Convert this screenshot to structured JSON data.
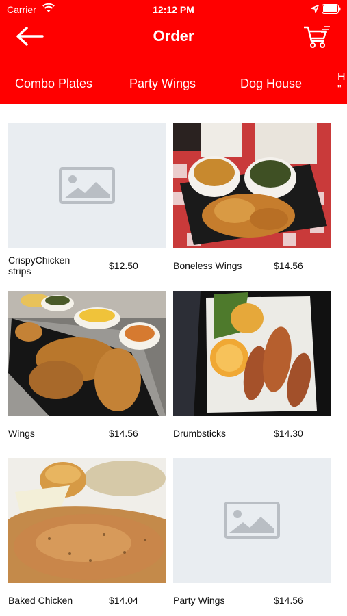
{
  "status": {
    "carrier": "Carrier",
    "time": "12:12 PM"
  },
  "nav": {
    "title": "Order",
    "back_icon": "arrow-left-icon",
    "cart_icon": "cart-icon"
  },
  "tabs": [
    "Combo Plates",
    "Party Wings",
    "Dog House"
  ],
  "tab_partial": {
    "line1": "H",
    "line2": "\""
  },
  "products": [
    {
      "name": "CrispyChicken strips",
      "price": "$12.50",
      "image": "placeholder"
    },
    {
      "name": "Boneless Wings",
      "price": "$14.56",
      "image": "boneless"
    },
    {
      "name": "Wings",
      "price": "$14.56",
      "image": "wings"
    },
    {
      "name": "Drumbsticks",
      "price": "$14.30",
      "image": "drumsticks"
    },
    {
      "name": "Baked Chicken",
      "price": "$14.04",
      "image": "baked"
    },
    {
      "name": "Party Wings",
      "price": "$14.56",
      "image": "placeholder"
    }
  ],
  "colors": {
    "header": "#ff0000",
    "placeholder_bg": "#e9edf1",
    "placeholder_icon": "#b9bec4"
  }
}
